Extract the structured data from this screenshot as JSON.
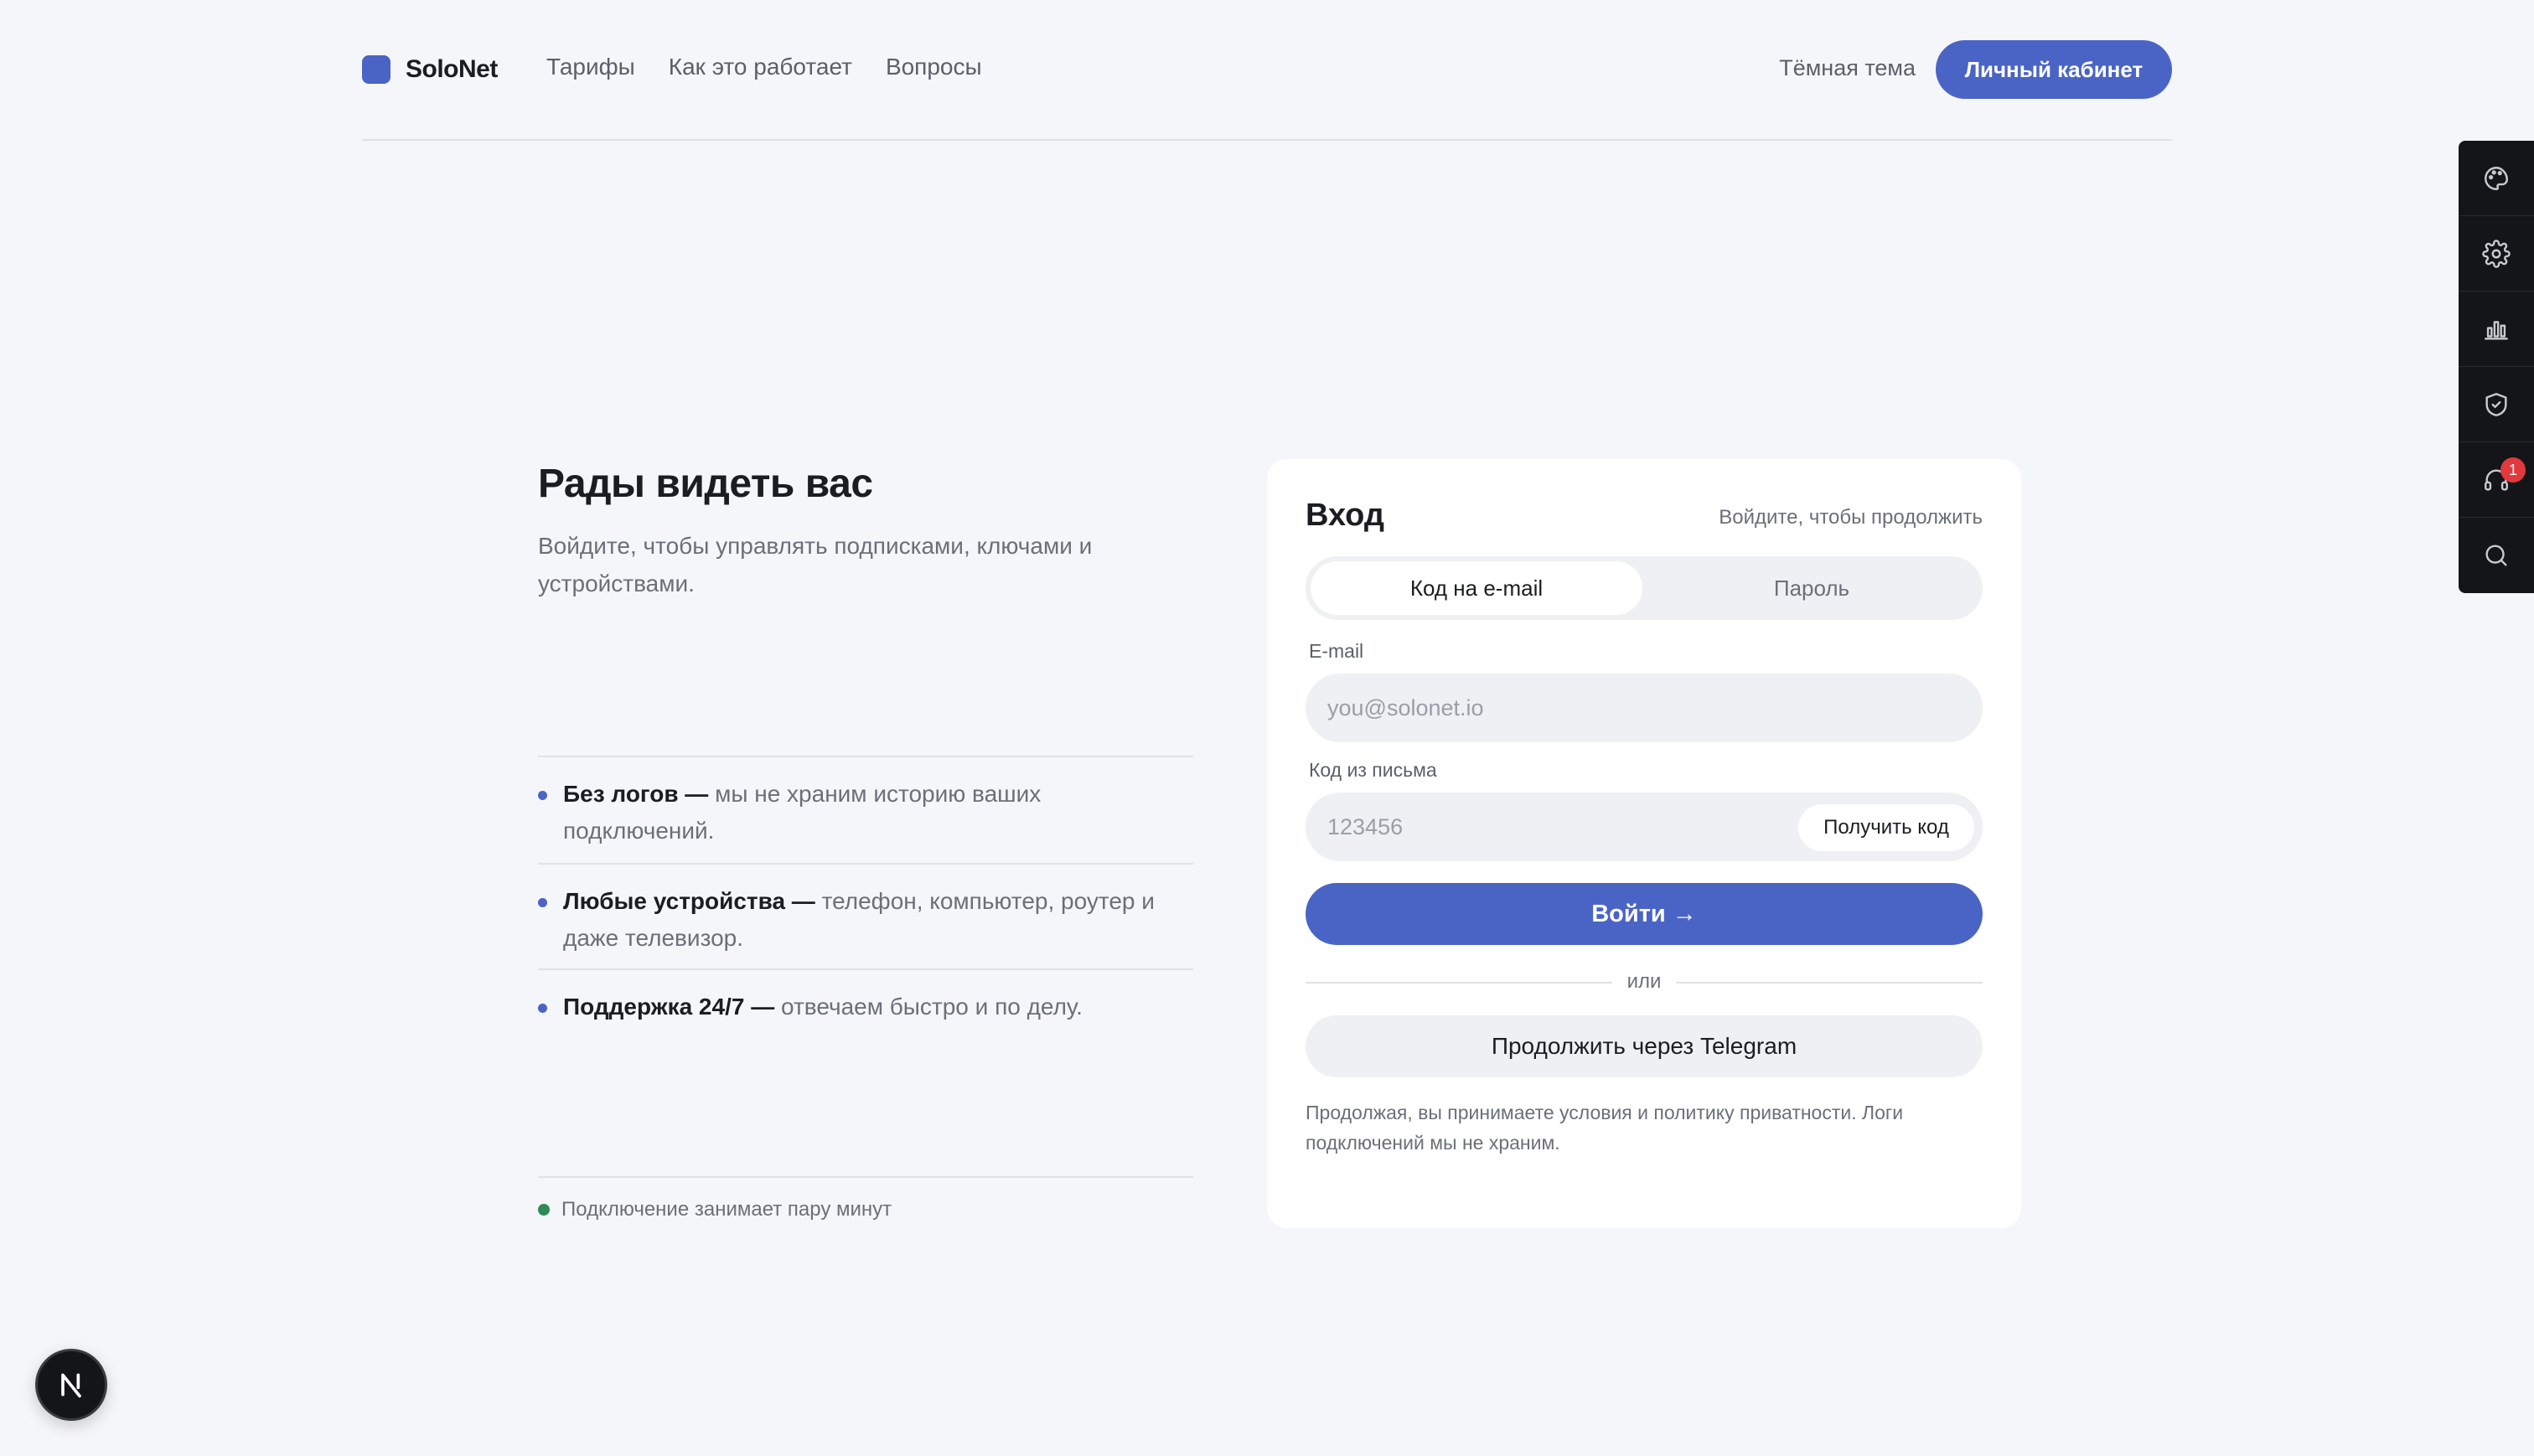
{
  "header": {
    "brand": "SoloNet",
    "nav": [
      "Тарифы",
      "Как это работает",
      "Вопросы"
    ],
    "theme_toggle": "Тёмная тема",
    "cabinet": "Личный кабинет"
  },
  "hero": {
    "title": "Рады видеть вас",
    "subtitle": "Войдите, чтобы управлять подписками, ключами и устройствами."
  },
  "features": [
    {
      "bold": "Без логов —",
      "text": " мы не храним историю ваших подключений."
    },
    {
      "bold": "Любые устройства —",
      "text": " телефон, компьютер, роутер и даже телевизор."
    },
    {
      "bold": "Поддержка 24/7 —",
      "text": " отвечаем быстро и по делу."
    }
  ],
  "status_text": "Подключение занимает пару минут",
  "login": {
    "title": "Вход",
    "hint": "Войдите, чтобы продолжить",
    "tabs": [
      "Код на e-mail",
      "Пароль"
    ],
    "email_label": "E-mail",
    "email_placeholder": "you@solonet.io",
    "code_label": "Код из письма",
    "code_placeholder": "123456",
    "get_code": "Получить код",
    "submit": "Войти →",
    "or": "или",
    "telegram": "Продолжить через Telegram",
    "legal": "Продолжая, вы принимаете условия и политику приватности. Логи подключений мы не храним."
  },
  "toolbar": {
    "icons": [
      "palette-icon",
      "gear-icon",
      "chart-icon",
      "shield-icon",
      "headset-icon",
      "search-icon"
    ],
    "badge": "1"
  },
  "next_logo": "N",
  "colors": {
    "accent": "#4a64c6",
    "background": "#f5f6f9",
    "toolbar": "#141518",
    "badge": "#e0393e",
    "status": "#2e8b57"
  }
}
